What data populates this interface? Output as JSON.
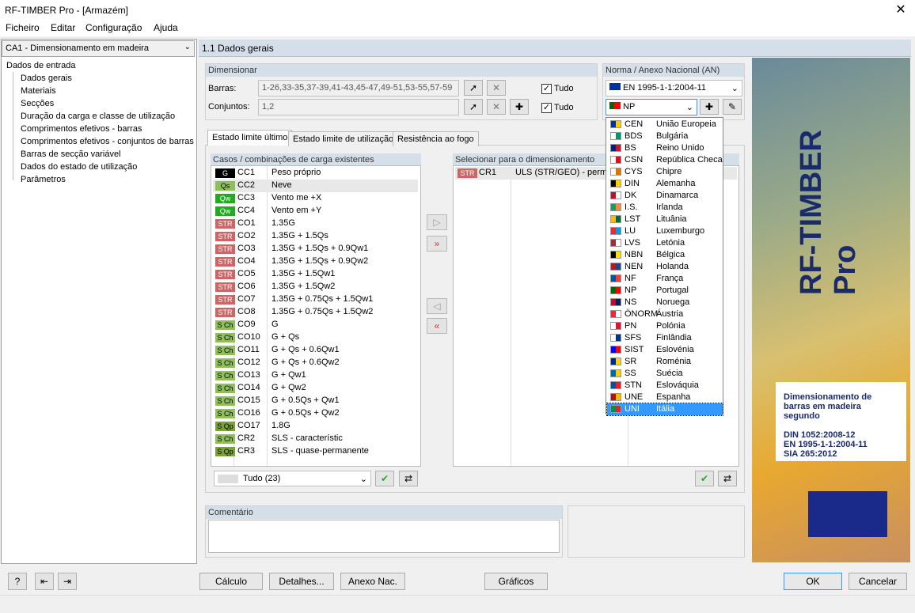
{
  "window": {
    "title": "RF-TIMBER Pro - [Armazém]",
    "close": "✕"
  },
  "menu": [
    "Ficheiro",
    "Editar",
    "Configuração",
    "Ajuda"
  ],
  "case_selector": {
    "value": "CA1 - Dimensionamento em madeira"
  },
  "tree": {
    "root": "Dados de entrada",
    "items": [
      "Dados gerais",
      "Materiais",
      "Secções",
      "Duração da carga e classe de utilização",
      "Comprimentos efetivos - barras",
      "Comprimentos efetivos - conjuntos de barras",
      "Barras de secção variável",
      "Dados do estado de utilização",
      "Parâmetros"
    ]
  },
  "header": {
    "title": "1.1 Dados gerais"
  },
  "dimension": {
    "title": "Dimensionar",
    "bars_label": "Barras:",
    "bars_value": "1-26,33-35,37-39,41-43,45-47,49-51,53-55,57-59",
    "sets_label": "Conjuntos:",
    "sets_value": "1,2",
    "all_label": "Tudo"
  },
  "norm": {
    "title": "Norma / Anexo Nacional (AN)",
    "standard": "EN 1995-1-1:2004-11",
    "annex": "NP"
  },
  "tabs": [
    "Estado limite último",
    "Estado limite de utilização",
    "Resistência ao fogo"
  ],
  "existing": {
    "title": "Casos / combinações de carga existentes",
    "filter": "Tudo (23)",
    "rows": [
      {
        "badge": "G",
        "id": "CC1",
        "desc": "Peso próprio",
        "color": "#000000",
        "text": "#ffffff"
      },
      {
        "badge": "Qs",
        "id": "CC2",
        "desc": "Neve",
        "color": "#8fbf5a",
        "text": "#000000"
      },
      {
        "badge": "Qw",
        "id": "CC3",
        "desc": "Vento me +X",
        "color": "#22aa22",
        "text": "#ffffff"
      },
      {
        "badge": "Qw",
        "id": "CC4",
        "desc": "Vento em +Y",
        "color": "#22aa22",
        "text": "#ffffff"
      },
      {
        "badge": "STR",
        "id": "CO1",
        "desc": "1.35G",
        "color": "#cc6666",
        "text": "#ffffff"
      },
      {
        "badge": "STR",
        "id": "CO2",
        "desc": "1.35G + 1.5Qs",
        "color": "#cc6666",
        "text": "#ffffff"
      },
      {
        "badge": "STR",
        "id": "CO3",
        "desc": "1.35G + 1.5Qs + 0.9Qw1",
        "color": "#cc6666",
        "text": "#ffffff"
      },
      {
        "badge": "STR",
        "id": "CO4",
        "desc": "1.35G + 1.5Qs + 0.9Qw2",
        "color": "#cc6666",
        "text": "#ffffff"
      },
      {
        "badge": "STR",
        "id": "CO5",
        "desc": "1.35G + 1.5Qw1",
        "color": "#cc6666",
        "text": "#ffffff"
      },
      {
        "badge": "STR",
        "id": "CO6",
        "desc": "1.35G + 1.5Qw2",
        "color": "#cc6666",
        "text": "#ffffff"
      },
      {
        "badge": "STR",
        "id": "CO7",
        "desc": "1.35G + 0.75Qs + 1.5Qw1",
        "color": "#cc6666",
        "text": "#ffffff"
      },
      {
        "badge": "STR",
        "id": "CO8",
        "desc": "1.35G + 0.75Qs + 1.5Qw2",
        "color": "#cc6666",
        "text": "#ffffff"
      },
      {
        "badge": "S Ch",
        "id": "CO9",
        "desc": "G",
        "color": "#8fbf5a",
        "text": "#000000"
      },
      {
        "badge": "S Ch",
        "id": "CO10",
        "desc": "G + Qs",
        "color": "#8fbf5a",
        "text": "#000000"
      },
      {
        "badge": "S Ch",
        "id": "CO11",
        "desc": "G + Qs + 0.6Qw1",
        "color": "#8fbf5a",
        "text": "#000000"
      },
      {
        "badge": "S Ch",
        "id": "CO12",
        "desc": "G + Qs + 0.6Qw2",
        "color": "#8fbf5a",
        "text": "#000000"
      },
      {
        "badge": "S Ch",
        "id": "CO13",
        "desc": "G + Qw1",
        "color": "#8fbf5a",
        "text": "#000000"
      },
      {
        "badge": "S Ch",
        "id": "CO14",
        "desc": "G + Qw2",
        "color": "#8fbf5a",
        "text": "#000000"
      },
      {
        "badge": "S Ch",
        "id": "CO15",
        "desc": "G + 0.5Qs + Qw1",
        "color": "#8fbf5a",
        "text": "#000000"
      },
      {
        "badge": "S Ch",
        "id": "CO16",
        "desc": "G + 0.5Qs + Qw2",
        "color": "#8fbf5a",
        "text": "#000000"
      },
      {
        "badge": "S Qp",
        "id": "CO17",
        "desc": "1.8G",
        "color": "#7aa03a",
        "text": "#000000"
      },
      {
        "badge": "S Ch",
        "id": "CR2",
        "desc": "SLS - característic",
        "color": "#8fbf5a",
        "text": "#000000"
      },
      {
        "badge": "S Qp",
        "id": "CR3",
        "desc": "SLS - quase-permanente",
        "color": "#7aa03a",
        "text": "#000000"
      }
    ]
  },
  "selected": {
    "title": "Selecionar para o dimensionamento",
    "rows": [
      {
        "badge": "STR",
        "id": "CR1",
        "desc": "ULS (STR/GEO) - perma"
      }
    ]
  },
  "annex_list": [
    {
      "code": "CEN",
      "name": "União Europeia",
      "c1": "#003399",
      "c2": "#ffcc00"
    },
    {
      "code": "BDS",
      "name": "Bulgária",
      "c1": "#ffffff",
      "c2": "#00966e"
    },
    {
      "code": "BS",
      "name": "Reino Unido",
      "c1": "#00247d",
      "c2": "#cf142b"
    },
    {
      "code": "CSN",
      "name": "República Checa",
      "c1": "#ffffff",
      "c2": "#d7141a"
    },
    {
      "code": "CYS",
      "name": "Chipre",
      "c1": "#ffffff",
      "c2": "#d57800"
    },
    {
      "code": "DIN",
      "name": "Alemanha",
      "c1": "#000000",
      "c2": "#ffce00"
    },
    {
      "code": "DK",
      "name": "Dinamarca",
      "c1": "#c60c30",
      "c2": "#ffffff"
    },
    {
      "code": "I.S.",
      "name": "Irlanda",
      "c1": "#169b62",
      "c2": "#ff883e"
    },
    {
      "code": "LST",
      "name": "Lituânia",
      "c1": "#fdb913",
      "c2": "#006a44"
    },
    {
      "code": "LU",
      "name": "Luxemburgo",
      "c1": "#ed2939",
      "c2": "#00a1de"
    },
    {
      "code": "LVS",
      "name": "Letónia",
      "c1": "#9e3039",
      "c2": "#ffffff"
    },
    {
      "code": "NBN",
      "name": "Bélgica",
      "c1": "#000000",
      "c2": "#fdda24"
    },
    {
      "code": "NEN",
      "name": "Holanda",
      "c1": "#ae1c28",
      "c2": "#21468b"
    },
    {
      "code": "NF",
      "name": "França",
      "c1": "#0055a4",
      "c2": "#ef4135"
    },
    {
      "code": "NP",
      "name": "Portugal",
      "c1": "#006600",
      "c2": "#ff0000"
    },
    {
      "code": "NS",
      "name": "Noruega",
      "c1": "#ba0c2f",
      "c2": "#00205b"
    },
    {
      "code": "ÖNORM",
      "name": "Áustria",
      "c1": "#ed2939",
      "c2": "#ffffff"
    },
    {
      "code": "PN",
      "name": "Polónia",
      "c1": "#ffffff",
      "c2": "#dc143c"
    },
    {
      "code": "SFS",
      "name": "Finlândia",
      "c1": "#ffffff",
      "c2": "#003580"
    },
    {
      "code": "SIST",
      "name": "Eslovénia",
      "c1": "#0000ff",
      "c2": "#ff0000"
    },
    {
      "code": "SR",
      "name": "Roménia",
      "c1": "#002b7f",
      "c2": "#fcd116"
    },
    {
      "code": "SS",
      "name": "Suécia",
      "c1": "#006aa7",
      "c2": "#fecc00"
    },
    {
      "code": "STN",
      "name": "Eslováquia",
      "c1": "#0b4ea2",
      "c2": "#ee1c25"
    },
    {
      "code": "UNE",
      "name": "Espanha",
      "c1": "#aa151b",
      "c2": "#f1bf00"
    },
    {
      "code": "UNI",
      "name": "Itália",
      "c1": "#009246",
      "c2": "#ce2b37"
    }
  ],
  "annex_selected": "UNI",
  "comment": {
    "title": "Comentário"
  },
  "sidebar": {
    "brand": "RF-TIMBER Pro",
    "info_lines": [
      "Dimensionamento de",
      "barras em madeira",
      "segundo"
    ],
    "norms": [
      "DIN 1052:2008-12",
      "EN 1995-1-1:2004-11",
      "SIA 265:2012"
    ]
  },
  "buttons": {
    "calc": "Cálculo",
    "details": "Detalhes...",
    "annex": "Anexo Nac.",
    "graphics": "Gráficos",
    "ok": "OK",
    "cancel": "Cancelar"
  },
  "colors": {
    "header": "#d5dfe9",
    "selection": "#3399ff"
  }
}
